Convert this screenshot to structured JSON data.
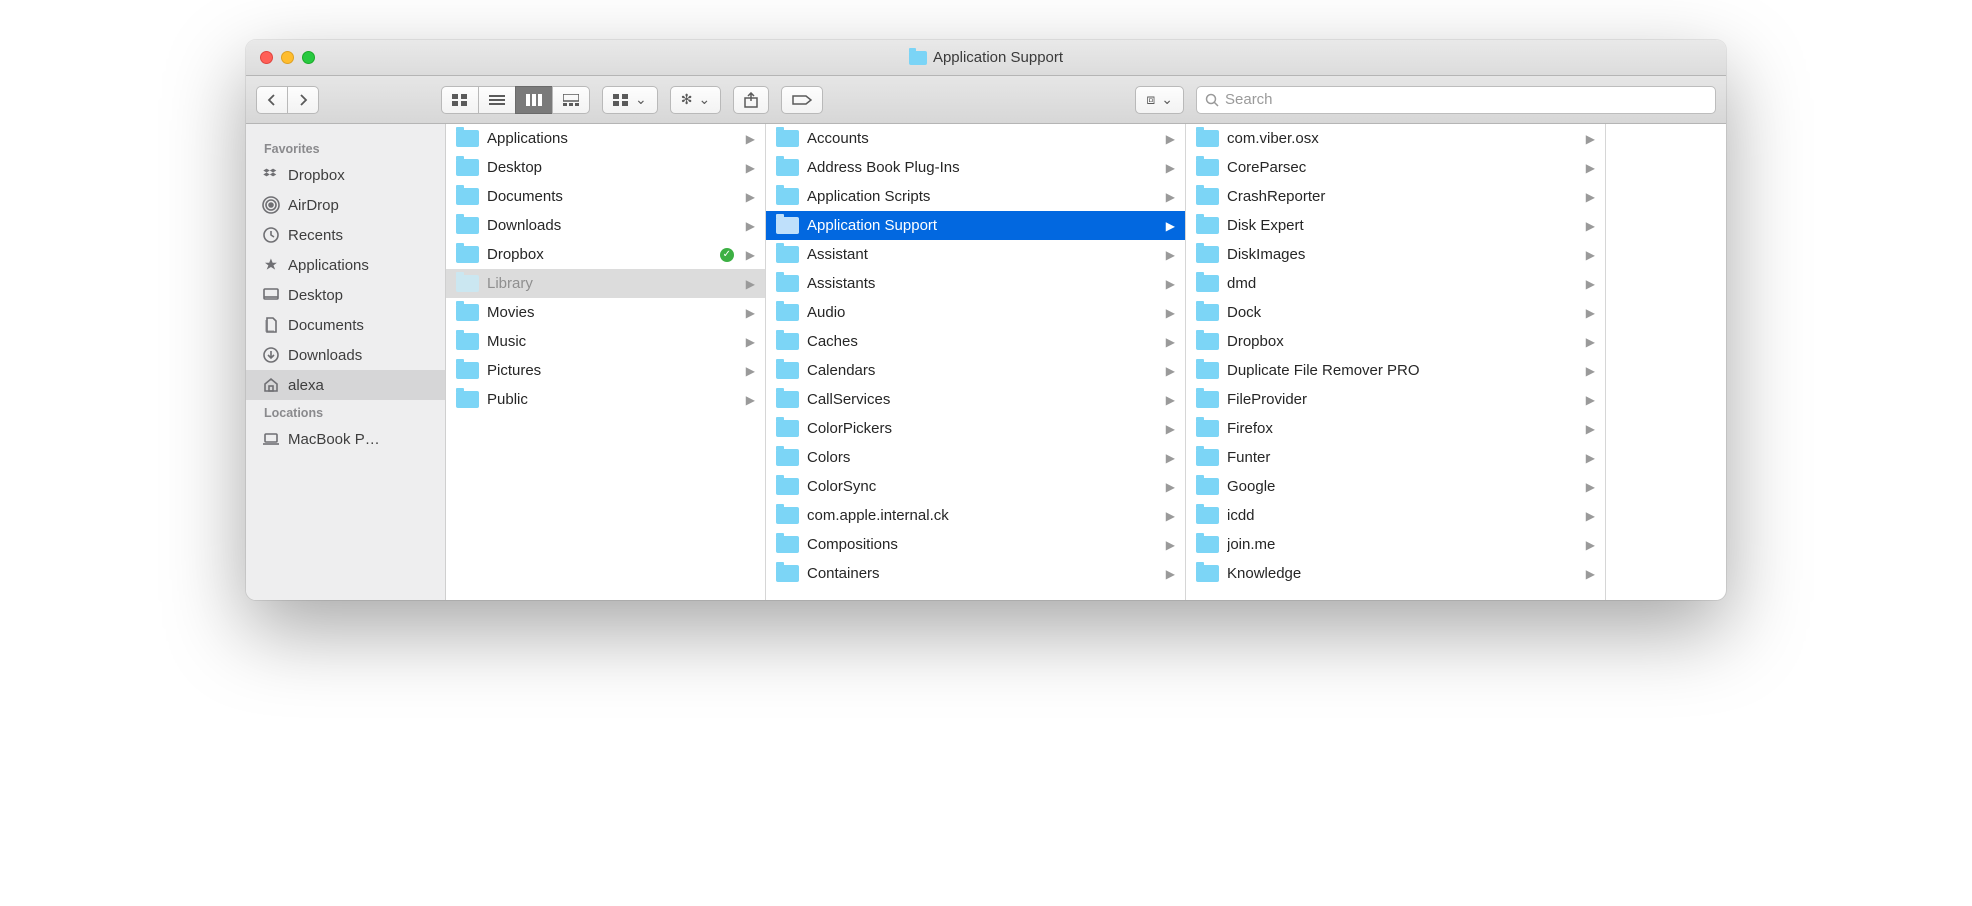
{
  "window": {
    "title": "Application Support"
  },
  "search": {
    "placeholder": "Search"
  },
  "sidebar": {
    "sections": [
      {
        "header": "Favorites",
        "items": [
          {
            "label": "Dropbox",
            "icon": "dropbox"
          },
          {
            "label": "AirDrop",
            "icon": "airdrop"
          },
          {
            "label": "Recents",
            "icon": "recents"
          },
          {
            "label": "Applications",
            "icon": "applications"
          },
          {
            "label": "Desktop",
            "icon": "desktop"
          },
          {
            "label": "Documents",
            "icon": "documents"
          },
          {
            "label": "Downloads",
            "icon": "downloads"
          },
          {
            "label": "alexa",
            "icon": "home",
            "selected": true
          }
        ]
      },
      {
        "header": "Locations",
        "items": [
          {
            "label": "MacBook P…",
            "icon": "laptop"
          }
        ]
      }
    ]
  },
  "columns": [
    {
      "items": [
        {
          "label": "Applications",
          "hasChildren": true
        },
        {
          "label": "Desktop",
          "hasChildren": true
        },
        {
          "label": "Documents",
          "hasChildren": true
        },
        {
          "label": "Downloads",
          "hasChildren": true
        },
        {
          "label": "Dropbox",
          "hasChildren": true,
          "synced": true
        },
        {
          "label": "Library",
          "hasChildren": true,
          "state": "inactive-selected"
        },
        {
          "label": "Movies",
          "hasChildren": true
        },
        {
          "label": "Music",
          "hasChildren": true
        },
        {
          "label": "Pictures",
          "hasChildren": true
        },
        {
          "label": "Public",
          "hasChildren": true
        }
      ]
    },
    {
      "items": [
        {
          "label": "Accounts",
          "hasChildren": true
        },
        {
          "label": "Address Book Plug-Ins",
          "hasChildren": true
        },
        {
          "label": "Application Scripts",
          "hasChildren": true
        },
        {
          "label": "Application Support",
          "hasChildren": true,
          "state": "active-selected"
        },
        {
          "label": "Assistant",
          "hasChildren": true
        },
        {
          "label": "Assistants",
          "hasChildren": true
        },
        {
          "label": "Audio",
          "hasChildren": true
        },
        {
          "label": "Caches",
          "hasChildren": true
        },
        {
          "label": "Calendars",
          "hasChildren": true
        },
        {
          "label": "CallServices",
          "hasChildren": true
        },
        {
          "label": "ColorPickers",
          "hasChildren": true
        },
        {
          "label": "Colors",
          "hasChildren": true
        },
        {
          "label": "ColorSync",
          "hasChildren": true
        },
        {
          "label": "com.apple.internal.ck",
          "hasChildren": true
        },
        {
          "label": "Compositions",
          "hasChildren": true
        },
        {
          "label": "Containers",
          "hasChildren": true
        }
      ]
    },
    {
      "items": [
        {
          "label": "com.viber.osx",
          "hasChildren": true,
          "cut": true
        },
        {
          "label": "CoreParsec",
          "hasChildren": true
        },
        {
          "label": "CrashReporter",
          "hasChildren": true
        },
        {
          "label": "Disk Expert",
          "hasChildren": true
        },
        {
          "label": "DiskImages",
          "hasChildren": true
        },
        {
          "label": "dmd",
          "hasChildren": true
        },
        {
          "label": "Dock",
          "hasChildren": true
        },
        {
          "label": "Dropbox",
          "hasChildren": true
        },
        {
          "label": "Duplicate File Remover PRO",
          "hasChildren": true
        },
        {
          "label": "FileProvider",
          "hasChildren": true
        },
        {
          "label": "Firefox",
          "hasChildren": true
        },
        {
          "label": "Funter",
          "hasChildren": true
        },
        {
          "label": "Google",
          "hasChildren": true
        },
        {
          "label": "icdd",
          "hasChildren": true
        },
        {
          "label": "join.me",
          "hasChildren": true
        },
        {
          "label": "Knowledge",
          "hasChildren": true
        }
      ]
    }
  ]
}
